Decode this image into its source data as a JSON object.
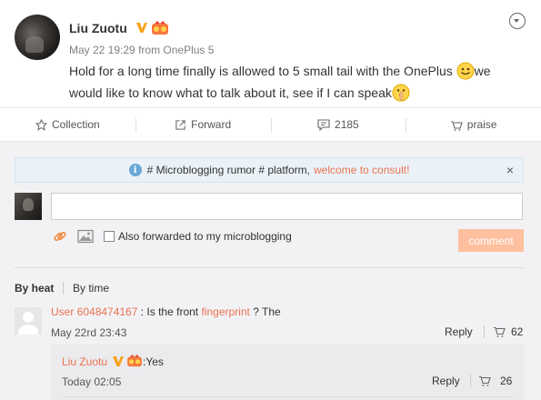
{
  "post": {
    "author": "Liu Zuotu",
    "date": "May 22 19:29",
    "source_prefix": "from",
    "source": "OnePlus 5",
    "text_part1": "Hold for a long time finally is allowed to 5 small tail with the OnePlus ",
    "text_part2": "we would like to know what to talk about it, see if I can speak",
    "verified_color": "#f9a11b"
  },
  "actions": [
    {
      "label": "Collection",
      "icon": "star-icon"
    },
    {
      "label": "Forward",
      "icon": "forward-icon"
    },
    {
      "label": "2185",
      "icon": "comment-icon"
    },
    {
      "label": "praise",
      "icon": "thumbs-up-icon"
    }
  ],
  "notice": {
    "text": "# Microblogging rumor # platform,",
    "link": "welcome to consult!",
    "close": "×"
  },
  "composer": {
    "input_value": "",
    "forward_label": "Also forwarded to my microblogging",
    "forward_checked": false,
    "submit_label": "comment"
  },
  "sort": {
    "heat": "By heat",
    "time": "By time"
  },
  "comment": {
    "user": "User 6048474167",
    "text_before": ": Is the front",
    "keyword": "fingerprint",
    "text_after": "? The",
    "time": "May 22rd 23:43",
    "reply": "Reply",
    "likes": "62"
  },
  "subcomment": {
    "user": "Liu Zuotu",
    "text": ":Yes",
    "time": "Today 02:05",
    "reply": "Reply",
    "likes": "26"
  },
  "colors": {
    "accent": "#eb7350",
    "comment_button": "#ffc09f",
    "notice_bg": "#eaf2f8",
    "comments_bg": "#f2f2f5"
  }
}
